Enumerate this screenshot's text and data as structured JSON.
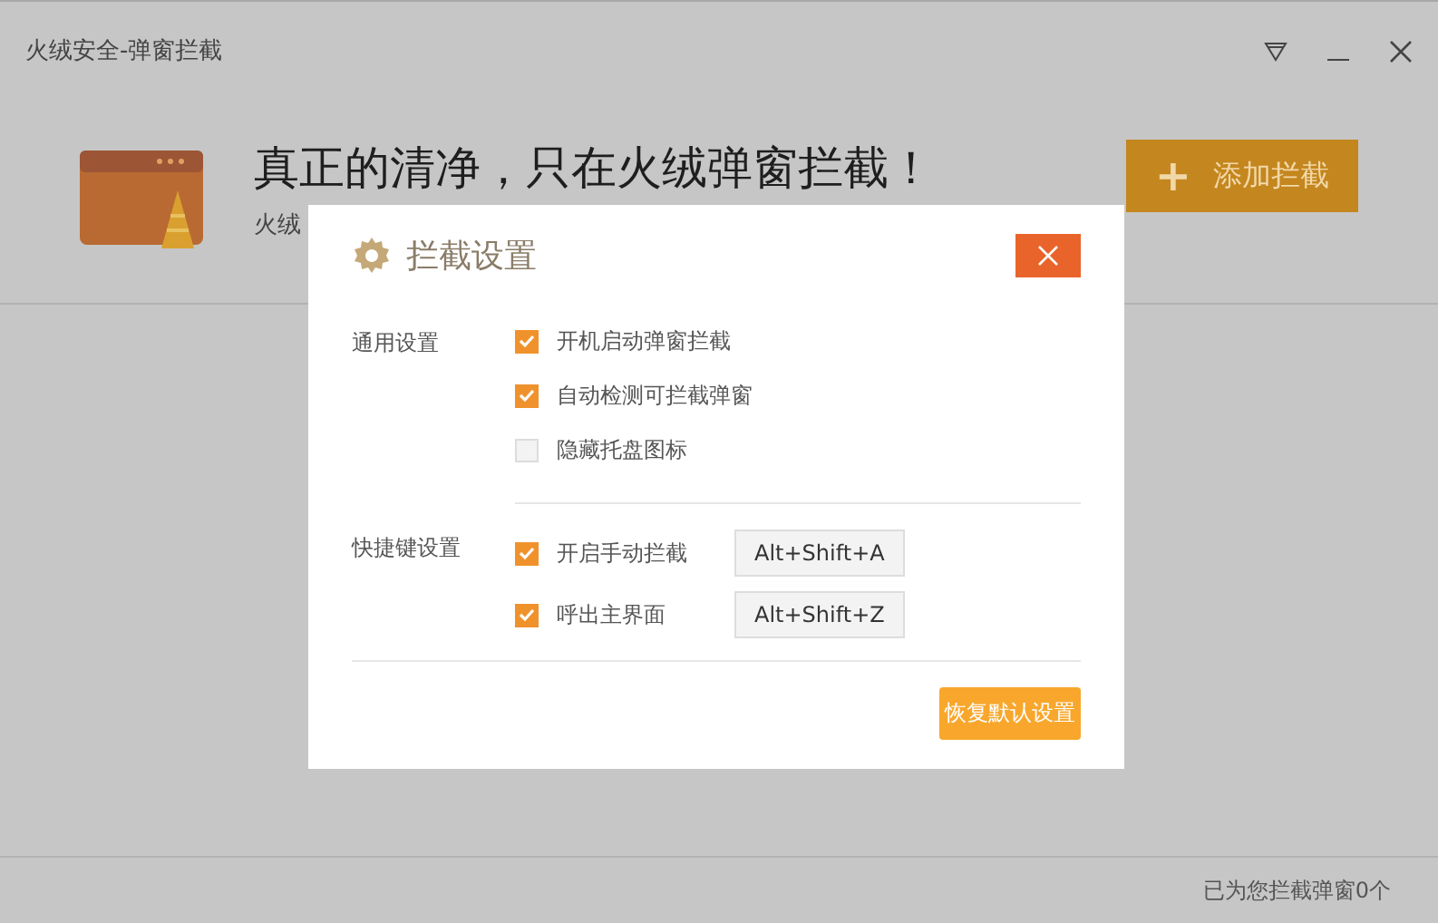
{
  "window": {
    "title": "火绒安全-弹窗拦截"
  },
  "header": {
    "headline": "真正的清净，只在火绒弹窗拦截！",
    "subtitle": "火绒",
    "add_button": {
      "icon": "+",
      "label": "添加拦截"
    }
  },
  "status_bar": {
    "text": "已为您拦截弹窗0个"
  },
  "dialog": {
    "title": "拦截设置",
    "sections": [
      {
        "label": "通用设置",
        "options": [
          {
            "label": "开机启动弹窗拦截",
            "checked": true
          },
          {
            "label": "自动检测可拦截弹窗",
            "checked": true
          },
          {
            "label": "隐藏托盘图标",
            "checked": false
          }
        ]
      },
      {
        "label": "快捷键设置",
        "options": [
          {
            "label": "开启手动拦截",
            "checked": true,
            "hotkey": "Alt+Shift+A"
          },
          {
            "label": "呼出主界面",
            "checked": true,
            "hotkey": "Alt+Shift+Z"
          }
        ]
      }
    ],
    "reset_button": "恢复默认设置"
  }
}
